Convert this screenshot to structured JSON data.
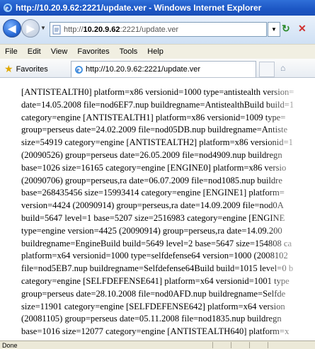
{
  "window": {
    "title": "http://10.20.9.62:2221/update.ver - Windows Internet Explorer"
  },
  "address": {
    "prefix": "http://",
    "host": "10.20.9.62",
    "rest": ":2221/update.ver"
  },
  "menu": [
    "File",
    "Edit",
    "View",
    "Favorites",
    "Tools",
    "Help"
  ],
  "favorites_bar": {
    "favorites_label": "Favorites",
    "tab_title": "http://10.20.9.62:2221/update.ver"
  },
  "content_text": "[ANTISTEALTH0] platform=x86 versionid=1000 type=antistealth version=\ndate=14.05.2008 file=nod6EF7.nup buildregname=AntistealthBuild build=1\ncategory=engine [ANTISTEALTH1] platform=x86 versionid=1009 type=\ngroup=perseus date=24.02.2009 file=nod05DB.nup buildregname=Antiste\nsize=54919 category=engine [ANTISTEALTH2] platform=x86 versionid=1\n(20090526) group=perseus date=26.05.2009 file=nod4909.nup buildregn\nbase=1026 size=16165 category=engine [ENGINE0] platform=x86 versio\n(20090706) group=perseus,ra date=06.07.2009 file=nod1085.nup buildre\nbase=268435456 size=15993414 category=engine [ENGINE1] platform=\nversion=4424 (20090914) group=perseus,ra date=14.09.2009 file=nod0A\nbuild=5647 level=1 base=5207 size=2516983 category=engine [ENGINE\ntype=engine version=4425 (20090914) group=perseus,ra date=14.09.200\nbuildregname=EngineBuild build=5649 level=2 base=5647 size=154808 ca\nplatform=x64 versionid=1000 type=selfdefense64 version=1000 (2008102\nfile=nod5EB7.nup buildregname=Selfdefense64Build build=1015 level=0 b\ncategory=engine [SELFDEFENSE641] platform=x64 versionid=1001 type\ngroup=perseus date=28.10.2008 file=nod0AFD.nup buildregname=Selfde\nsize=11901 category=engine [SELFDEFENSE642] platform=x64 version\n(20081105) group=perseus date=05.11.2008 file=nod1835.nup buildregn\nbase=1016 size=12077 category=engine [ANTISTEALTH640] platform=x\nversion=1000 (20080514) group=perseus date=14.05.2008 file=nod2FB",
  "status": {
    "text": "Done"
  }
}
